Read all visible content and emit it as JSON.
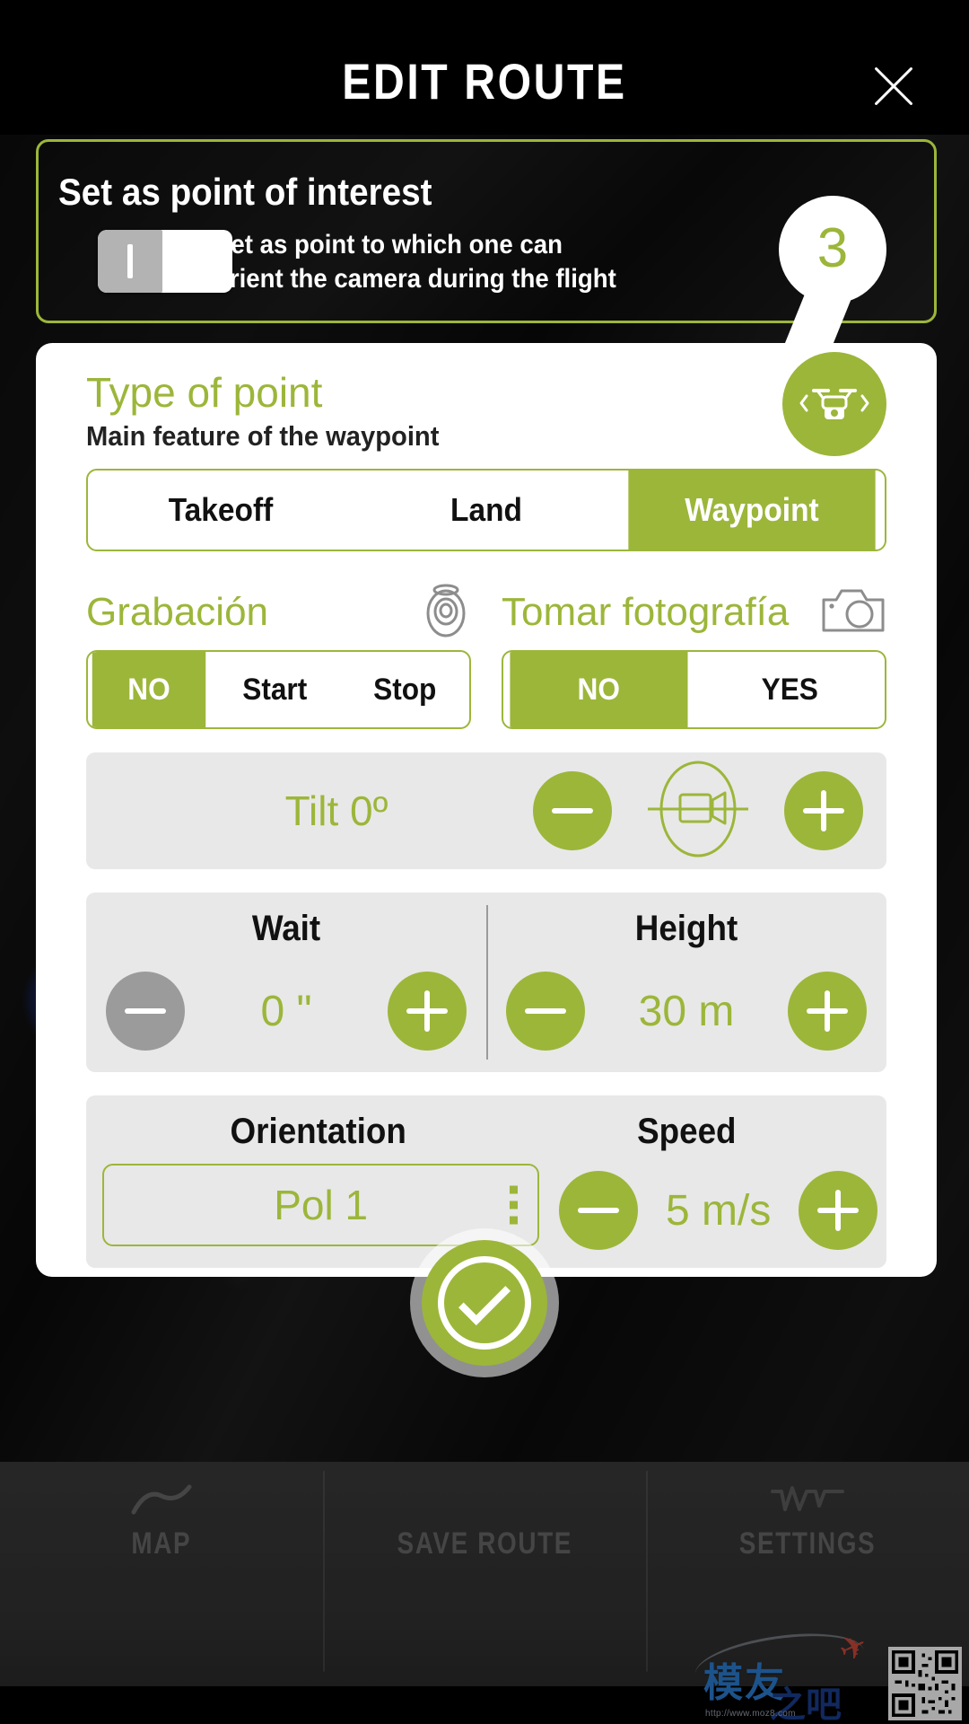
{
  "header": {
    "title": "EDIT ROUTE",
    "close_icon": "close-icon"
  },
  "point_of_interest": {
    "title": "Set as point of interest",
    "description": "Set as point to which one can orient the camera during the flight",
    "toggle_state": "off",
    "marker_number": "3"
  },
  "type_of_point": {
    "title": "Type of point",
    "subtitle": "Main feature of the waypoint",
    "drone_icon": "drone-icon",
    "prev_icon": "chevron-left-icon",
    "next_icon": "chevron-right-icon",
    "options": [
      {
        "label": "Takeoff",
        "selected": false
      },
      {
        "label": "Land",
        "selected": false
      },
      {
        "label": "Waypoint",
        "selected": true
      }
    ]
  },
  "recording": {
    "label": "Grabación",
    "icon": "video-reel-icon",
    "options": [
      {
        "label": "NO",
        "selected": true
      },
      {
        "label": "Start",
        "selected": false
      },
      {
        "label": "Stop",
        "selected": false
      }
    ]
  },
  "photo": {
    "label": "Tomar fotografía",
    "icon": "camera-icon",
    "options": [
      {
        "label": "NO",
        "selected": true
      },
      {
        "label": "YES",
        "selected": false
      }
    ]
  },
  "tilt": {
    "label": "Tilt 0º",
    "icon": "gimbal-camera-icon",
    "minus_label": "−",
    "plus_label": "+"
  },
  "wait": {
    "label": "Wait",
    "value": "0 \"",
    "minus_enabled": false
  },
  "height": {
    "label": "Height",
    "value": "30 m",
    "minus_enabled": true
  },
  "orientation": {
    "label": "Orientation",
    "value": "Pol 1",
    "menu_icon": "kebab-menu-icon"
  },
  "speed": {
    "label": "Speed",
    "value": "5 m/s",
    "minus_enabled": true
  },
  "save_button": {
    "icon": "check-circle-icon"
  },
  "bottom_nav": [
    {
      "label": "MAP",
      "icon": "map-icon"
    },
    {
      "label": "SAVE ROUTE",
      "icon": "save-icon"
    },
    {
      "label": "SETTINGS",
      "icon": "settings-icon"
    }
  ],
  "watermark": {
    "text_top": "模友",
    "text_bottom": "之吧",
    "url": "http://www.moz8.com"
  },
  "colors": {
    "accent_green": "#9cb63a",
    "panel_gray": "#e8e8e8",
    "disabled_gray": "#9b9b9b",
    "dark_bg": "#0d0d0d"
  }
}
